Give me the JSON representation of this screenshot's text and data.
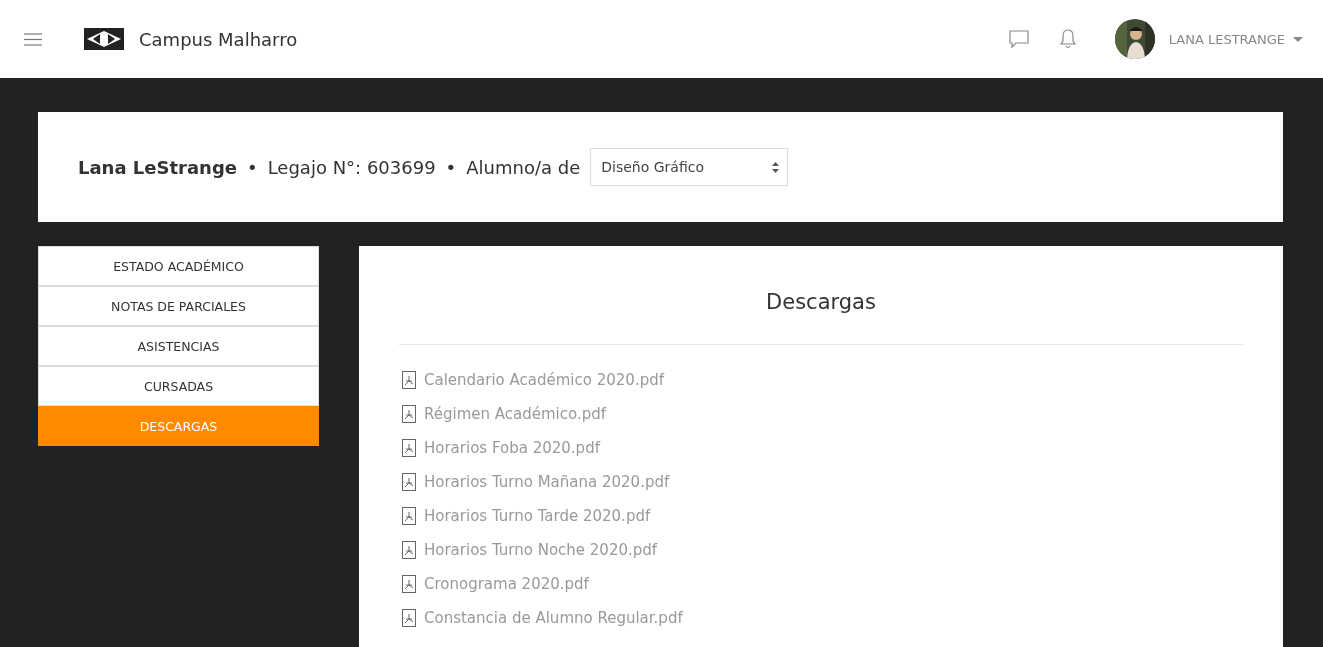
{
  "header": {
    "brand": "Campus Malharro",
    "user": "LANA LESTRANGE"
  },
  "profile": {
    "name": "Lana LeStrange",
    "sep1": "•",
    "legajo": "Legajo N°: 603699",
    "sep2": "•",
    "alumno": "Alumno/a de",
    "career": "Diseño Gráfico"
  },
  "sidebar": {
    "items": [
      {
        "label": "ESTADO ACADÉMICO",
        "selected": false
      },
      {
        "label": "NOTAS DE PARCIALES",
        "selected": false
      },
      {
        "label": "ASISTENCIAS",
        "selected": false
      },
      {
        "label": "CURSADAS",
        "selected": false
      },
      {
        "label": "DESCARGAS",
        "selected": true
      }
    ]
  },
  "content": {
    "title": "Descargas",
    "files": [
      "Calendario Académico 2020.pdf",
      "Régimen Académico.pdf",
      "Horarios Foba 2020.pdf",
      "Horarios Turno Mañana 2020.pdf",
      "Horarios Turno Tarde 2020.pdf",
      "Horarios Turno Noche 2020.pdf",
      "Cronograma 2020.pdf",
      "Constancia de Alumno Regular.pdf"
    ]
  }
}
